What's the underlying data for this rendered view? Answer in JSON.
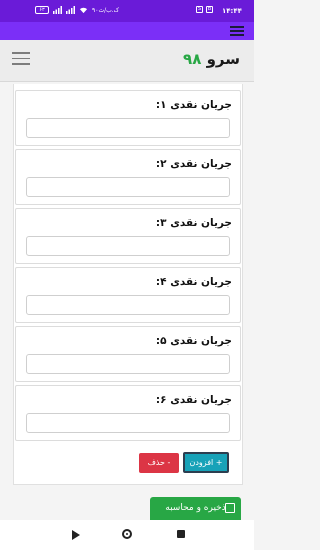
{
  "status_bar": {
    "time": "۱۴:۴۴",
    "battery": "۶۳",
    "speed": "۹۰ک.ب/ث"
  },
  "app": {
    "brand_text": "سرو",
    "brand_number": "۹۸"
  },
  "form": {
    "items": [
      {
        "label": "جریان نقدی ۱:",
        "value": ""
      },
      {
        "label": "جریان نقدی ۲:",
        "value": ""
      },
      {
        "label": "جریان نقدی ۳:",
        "value": ""
      },
      {
        "label": "جریان نقدی ۴:",
        "value": ""
      },
      {
        "label": "جریان نقدی ۵:",
        "value": ""
      },
      {
        "label": "جریان نقدی ۶:",
        "value": ""
      }
    ],
    "add_label": "+ افزودن",
    "delete_label": "- حذف"
  },
  "save_label": "ذخیره و محاسبه",
  "colors": {
    "status_bar": "#6a1bd8",
    "app_strip": "#7b2ff7",
    "brand_number": "#28a745",
    "delete_button": "#dc3545",
    "add_button": "#17a2b8",
    "save_button": "#28a745"
  }
}
